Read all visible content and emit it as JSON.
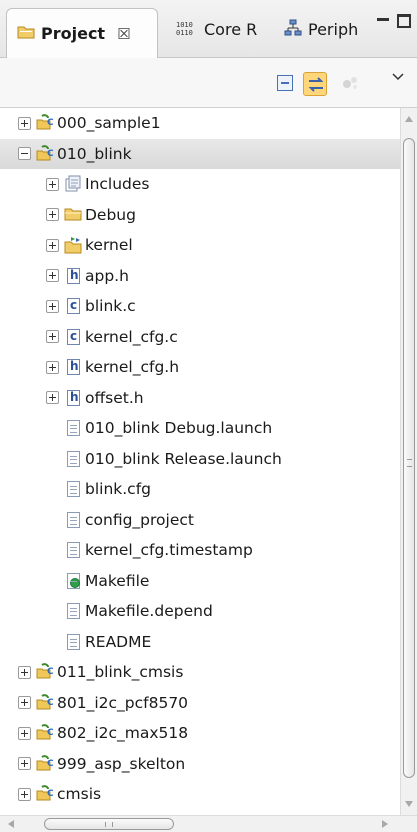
{
  "tabs": [
    {
      "label": "Project",
      "close": "☒",
      "icon": "folder-icon"
    },
    {
      "label": "Core R",
      "icon": "register-binary-icon"
    },
    {
      "label": "Periph",
      "icon": "peripheral-tree-icon"
    }
  ],
  "colors": {
    "selection": "#dcdcdc",
    "project_icon_accent": "#3f8a2b",
    "folder": "#e9b84d",
    "link_toggle": "#ffd77a"
  },
  "tree": [
    {
      "label": "000_sample1",
      "level": 0,
      "toggle": "plus",
      "icon": "c-project-icon"
    },
    {
      "label": "010_blink",
      "level": 0,
      "toggle": "minus",
      "icon": "c-project-icon",
      "selected": true
    },
    {
      "label": "Includes",
      "level": 1,
      "toggle": "plus",
      "icon": "includes-icon"
    },
    {
      "label": "Debug",
      "level": 1,
      "toggle": "plus",
      "icon": "folder-icon"
    },
    {
      "label": "kernel",
      "level": 1,
      "toggle": "plus",
      "icon": "linked-folder-icon"
    },
    {
      "label": "app.h",
      "level": 1,
      "toggle": "plus",
      "icon": "header-file-icon"
    },
    {
      "label": "blink.c",
      "level": 1,
      "toggle": "plus",
      "icon": "c-source-file-icon"
    },
    {
      "label": "kernel_cfg.c",
      "level": 1,
      "toggle": "plus",
      "icon": "c-source-file-icon"
    },
    {
      "label": "kernel_cfg.h",
      "level": 1,
      "toggle": "plus",
      "icon": "header-file-icon"
    },
    {
      "label": "offset.h",
      "level": 1,
      "toggle": "plus",
      "icon": "header-file-icon"
    },
    {
      "label": "010_blink Debug.launch",
      "level": 1,
      "toggle": "none",
      "icon": "file-icon"
    },
    {
      "label": "010_blink Release.launch",
      "level": 1,
      "toggle": "none",
      "icon": "file-icon"
    },
    {
      "label": "blink.cfg",
      "level": 1,
      "toggle": "none",
      "icon": "file-icon"
    },
    {
      "label": "config_project",
      "level": 1,
      "toggle": "none",
      "icon": "file-icon"
    },
    {
      "label": "kernel_cfg.timestamp",
      "level": 1,
      "toggle": "none",
      "icon": "file-icon"
    },
    {
      "label": "Makefile",
      "level": 1,
      "toggle": "none",
      "icon": "makefile-icon"
    },
    {
      "label": "Makefile.depend",
      "level": 1,
      "toggle": "none",
      "icon": "file-icon"
    },
    {
      "label": "README",
      "level": 1,
      "toggle": "none",
      "icon": "file-icon"
    },
    {
      "label": "011_blink_cmsis",
      "level": 0,
      "toggle": "plus",
      "icon": "c-project-icon"
    },
    {
      "label": "801_i2c_pcf8570",
      "level": 0,
      "toggle": "plus",
      "icon": "c-project-icon"
    },
    {
      "label": "802_i2c_max518",
      "level": 0,
      "toggle": "plus",
      "icon": "c-project-icon"
    },
    {
      "label": "999_asp_skelton",
      "level": 0,
      "toggle": "plus",
      "icon": "c-project-icon"
    },
    {
      "label": "cmsis",
      "level": 0,
      "toggle": "plus",
      "icon": "c-project-icon"
    }
  ]
}
